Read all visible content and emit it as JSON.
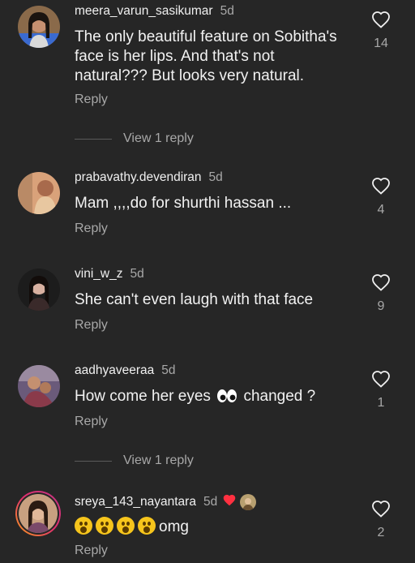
{
  "comments": [
    {
      "username": "meera_varun_sasikumar",
      "time": "5d",
      "text_lines": [
        "The only beautiful feature on Sobitha's",
        "face is her lips. And that's not",
        "natural??? But looks very natural."
      ],
      "reply_label": "Reply",
      "likes": "14",
      "view_replies": "View 1 reply"
    },
    {
      "username": "prabavathy.devendiran",
      "time": "5d",
      "text": "Mam ,,,,do for shurthi hassan ...",
      "reply_label": "Reply",
      "likes": "4"
    },
    {
      "username": "vini_w_z",
      "time": "5d",
      "text": "She can't even laugh with that face",
      "reply_label": "Reply",
      "likes": "9"
    },
    {
      "username": "aadhyaveeraa",
      "time": "5d",
      "text_before": "How come her eyes",
      "text_emoji": "eyes-emoji",
      "text_after": "changed ?",
      "reply_label": "Reply",
      "likes": "1",
      "view_replies": "View 1 reply"
    },
    {
      "username": "sreya_143_nayantara",
      "time": "5d",
      "badge": "red-heart-icon",
      "text_emoji": "astonished-face-emoji x4",
      "text_after": "omg",
      "reply_label": "Reply",
      "likes": "2"
    }
  ],
  "colors": {
    "background": "#262626",
    "primary_text": "#f5f5f5",
    "secondary_text": "#a8a8a8",
    "heart_red": "#ff3040",
    "story_ring": "#c13584"
  }
}
